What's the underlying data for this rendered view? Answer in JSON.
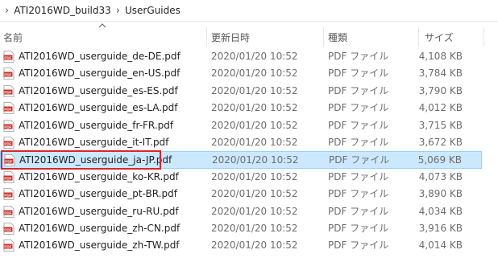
{
  "breadcrumb": {
    "items": [
      "ATI2016WD_build33",
      "UserGuides"
    ],
    "separator": "›"
  },
  "columns": {
    "name": "名前",
    "date": "更新日時",
    "type": "種類",
    "size": "サイズ"
  },
  "files": [
    {
      "name": "ATI2016WD_userguide_de-DE.pdf",
      "date": "2020/01/20 10:52",
      "type": "PDF ファイル",
      "size": "4,108 KB"
    },
    {
      "name": "ATI2016WD_userguide_en-US.pdf",
      "date": "2020/01/20 10:52",
      "type": "PDF ファイル",
      "size": "3,784 KB"
    },
    {
      "name": "ATI2016WD_userguide_es-ES.pdf",
      "date": "2020/01/20 10:52",
      "type": "PDF ファイル",
      "size": "3,790 KB"
    },
    {
      "name": "ATI2016WD_userguide_es-LA.pdf",
      "date": "2020/01/20 10:52",
      "type": "PDF ファイル",
      "size": "4,012 KB"
    },
    {
      "name": "ATI2016WD_userguide_fr-FR.pdf",
      "date": "2020/01/20 10:52",
      "type": "PDF ファイル",
      "size": "3,715 KB"
    },
    {
      "name": "ATI2016WD_userguide_it-IT.pdf",
      "date": "2020/01/20 10:52",
      "type": "PDF ファイル",
      "size": "3,672 KB"
    },
    {
      "name": "ATI2016WD_userguide_ja-JP.pdf",
      "date": "2020/01/20 10:52",
      "type": "PDF ファイル",
      "size": "5,069 KB",
      "selected": true
    },
    {
      "name": "ATI2016WD_userguide_ko-KR.pdf",
      "date": "2020/01/20 10:52",
      "type": "PDF ファイル",
      "size": "4,073 KB"
    },
    {
      "name": "ATI2016WD_userguide_pt-BR.pdf",
      "date": "2020/01/20 10:52",
      "type": "PDF ファイル",
      "size": "3,890 KB"
    },
    {
      "name": "ATI2016WD_userguide_ru-RU.pdf",
      "date": "2020/01/20 10:52",
      "type": "PDF ファイル",
      "size": "4,034 KB"
    },
    {
      "name": "ATI2016WD_userguide_zh-CN.pdf",
      "date": "2020/01/20 10:52",
      "type": "PDF ファイル",
      "size": "3,916 KB"
    },
    {
      "name": "ATI2016WD_userguide_zh-TW.pdf",
      "date": "2020/01/20 10:52",
      "type": "PDF ファイル",
      "size": "4,014 KB"
    }
  ],
  "icons": {
    "file": "pdf-file-icon",
    "icon_label": "PDF",
    "icon_color": "#c4302b",
    "sort": "sort-ascending-icon"
  },
  "colors": {
    "selection_bg": "#cce8ff",
    "selection_border": "#99d1ff",
    "highlight_box": "#d8262e"
  }
}
